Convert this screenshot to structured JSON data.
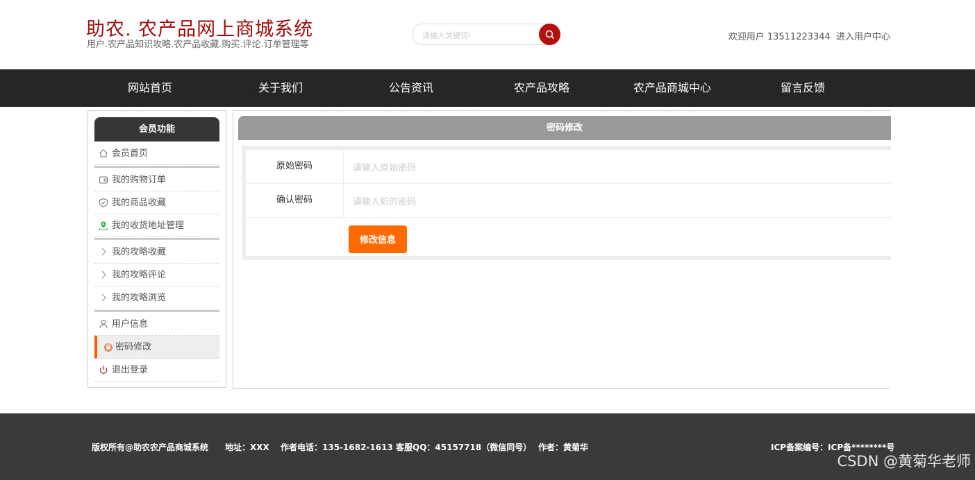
{
  "header": {
    "title": "助农. 农产品网上商城系统",
    "subtitle": "用户.农产品知识攻略.农产品收藏.购买.评论.订单管理等",
    "search_placeholder": "请输入关键词!",
    "welcome_label": "欢迎用户 13511223344",
    "user_center": "进入用户中心"
  },
  "nav": {
    "items": [
      {
        "label": "网站首页"
      },
      {
        "label": "关于我们"
      },
      {
        "label": "公告资讯"
      },
      {
        "label": "农产品攻略"
      },
      {
        "label": "农产品商城中心"
      },
      {
        "label": "留言反馈"
      }
    ]
  },
  "sidebar": {
    "header": "会员功能",
    "items": [
      {
        "label": "会员首页",
        "icon": "home-icon"
      },
      {
        "label": "我的购物订单",
        "icon": "wallet-icon"
      },
      {
        "label": "我的商品收藏",
        "icon": "shield-icon"
      },
      {
        "label": "我的收货地址管理",
        "icon": "location-icon"
      },
      {
        "label": "我的攻略收藏",
        "icon": "chevron-right-icon"
      },
      {
        "label": "我的攻略评论",
        "icon": "chevron-right-icon"
      },
      {
        "label": "我的攻略浏览",
        "icon": "chevron-right-icon"
      },
      {
        "label": "用户信息",
        "icon": "user-icon"
      },
      {
        "label": "密码修改",
        "icon": "lock-icon"
      },
      {
        "label": "退出登录",
        "icon": "power-icon"
      }
    ]
  },
  "main": {
    "title": "密码修改",
    "fields": [
      {
        "label": "原始密码",
        "placeholder": "请输入原始密码",
        "value": ""
      },
      {
        "label": "确认密码",
        "placeholder": "请输入新的密码",
        "value": ""
      }
    ],
    "submit_label": "修改信息"
  },
  "footer": {
    "copyright": "版权所有@助农农产品商城系统",
    "address": "地址：XXX",
    "phone": "作者电话：135-1682-1613",
    "qq": "客服QQ：45157718（微信同号）",
    "author": "作者：黄菊华",
    "icp": "ICP备案编号：ICP备********号"
  },
  "watermark": "CSDN @黄菊华老师",
  "colors": {
    "brand": "#a30d0d",
    "nav_bg": "#262626",
    "accent": "#ff6a00",
    "footer_bg": "#3a3a3a"
  }
}
